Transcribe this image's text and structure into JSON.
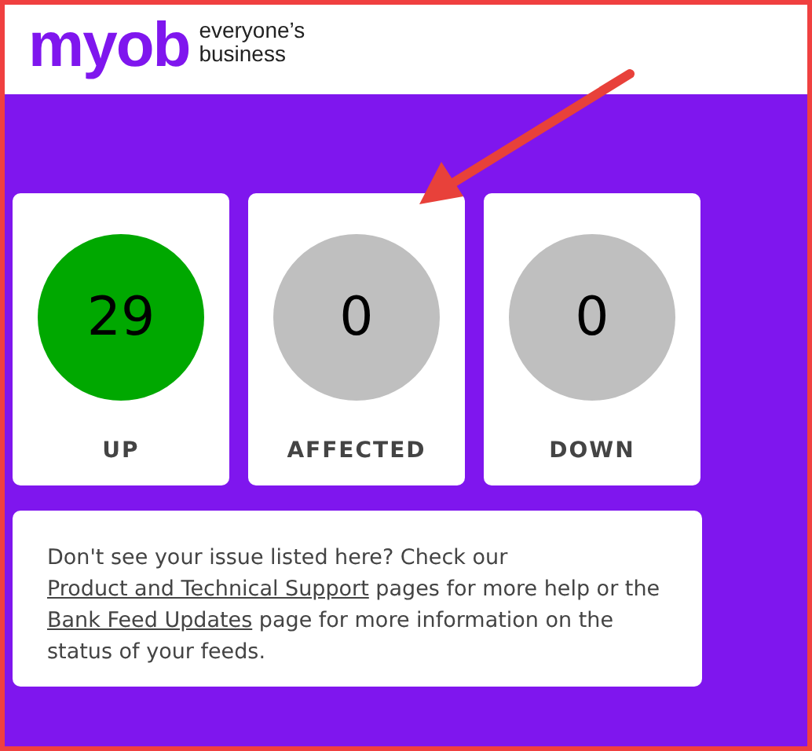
{
  "header": {
    "logo": "myob",
    "tagline": [
      "everyone’s",
      "business"
    ]
  },
  "statuses": [
    {
      "count": "29",
      "label": "UP",
      "color": "#00a800"
    },
    {
      "count": "0",
      "label": "AFFECTED",
      "color": "#bfbfbf"
    },
    {
      "count": "0",
      "label": "DOWN",
      "color": "#bfbfbf"
    }
  ],
  "notice": {
    "parts": [
      {
        "kind": "text",
        "text": "Don't see your issue listed here? Check our "
      },
      {
        "kind": "link",
        "text": "Product and Technical Support"
      },
      {
        "kind": "text",
        "text": " pages for more help or the "
      },
      {
        "kind": "link",
        "text": "Bank Feed Updates"
      },
      {
        "kind": "text",
        "text": " page for more information on the status of your feeds."
      }
    ]
  }
}
